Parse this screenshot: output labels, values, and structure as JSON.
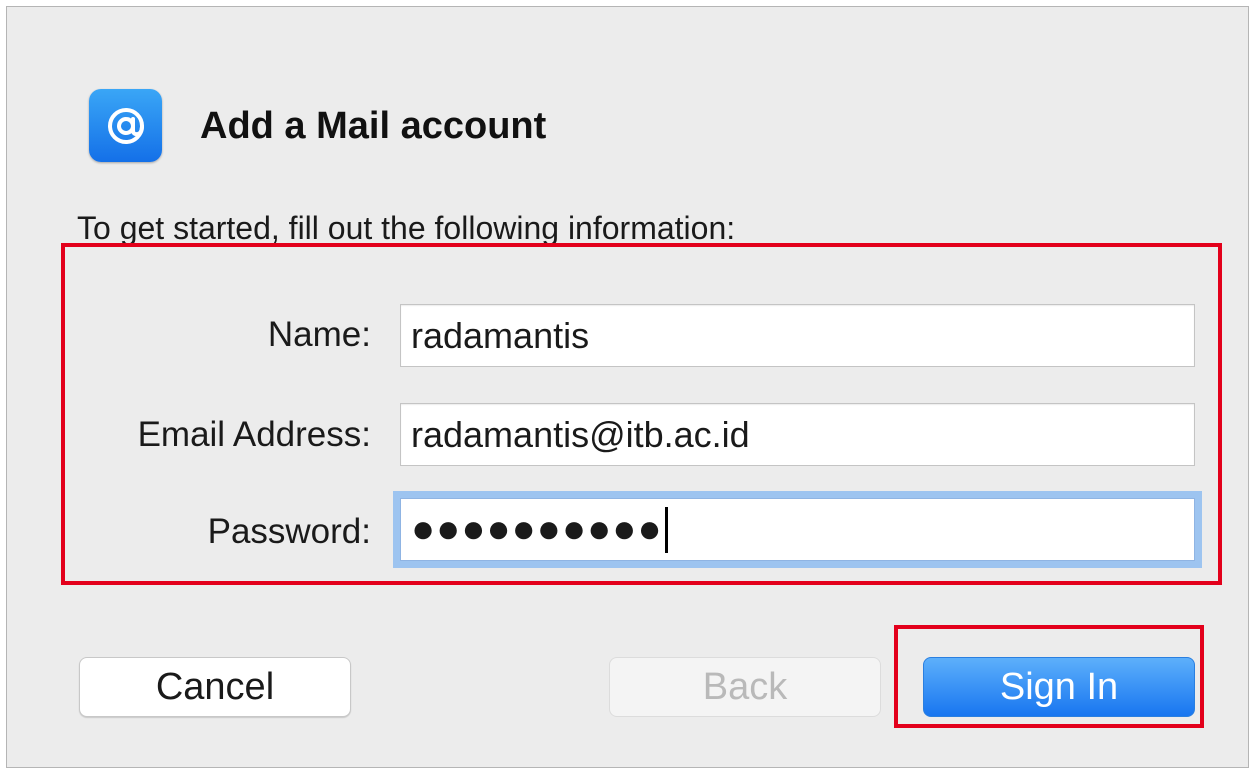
{
  "dialog": {
    "title": "Add a Mail account",
    "icon": "at-sign-icon",
    "intro": "To get started, fill out the following information:"
  },
  "form": {
    "name_label": "Name:",
    "name_value": "radamantis",
    "email_label": "Email Address:",
    "email_value": "radamantis@itb.ac.id",
    "password_label": "Password:",
    "password_masked": "●●●●●●●●●●"
  },
  "buttons": {
    "cancel": "Cancel",
    "back": "Back",
    "sign_in": "Sign In"
  },
  "colors": {
    "highlight": "#e3001b",
    "accent": "#1876f0"
  }
}
